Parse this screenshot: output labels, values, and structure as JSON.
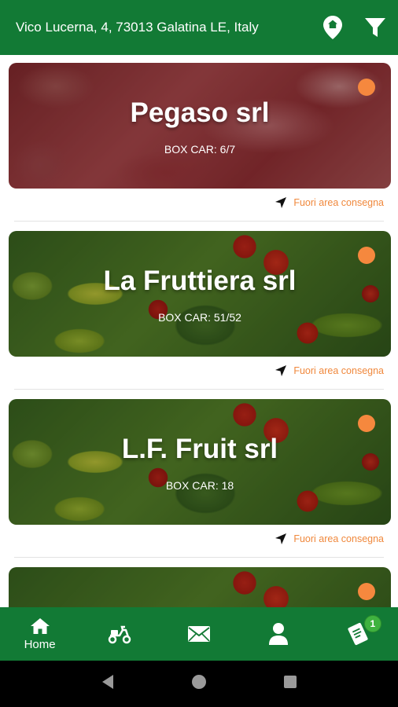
{
  "header": {
    "address": "Vico Lucerna, 4, 73013 Galatina LE, Italy",
    "icons": [
      "location-pin-icon",
      "filter-icon"
    ]
  },
  "stores": [
    {
      "name": "Pegaso srl",
      "box_car": "BOX CAR: 6/7",
      "status": "Fuori area consegna",
      "image": "meat"
    },
    {
      "name": "La Fruttiera srl",
      "box_car": "BOX CAR: 51/52",
      "status": "Fuori area consegna",
      "image": "vegetables"
    },
    {
      "name": "L.F. Fruit srl",
      "box_car": "BOX CAR: 18",
      "status": "Fuori area consegna",
      "image": "vegetables"
    }
  ],
  "colors": {
    "primary": "#127a35",
    "accent": "#f5883e",
    "status_text": "#f0883c",
    "badge": "#3fb23f"
  },
  "bottom_nav": {
    "items": [
      {
        "icon": "home-icon",
        "label": "Home",
        "active": true
      },
      {
        "icon": "scooter-icon"
      },
      {
        "icon": "mail-icon"
      },
      {
        "icon": "user-icon"
      },
      {
        "icon": "order-ticket-icon",
        "badge": "1"
      }
    ]
  },
  "system_nav": [
    "back-icon",
    "home-circle-icon",
    "recents-icon"
  ]
}
